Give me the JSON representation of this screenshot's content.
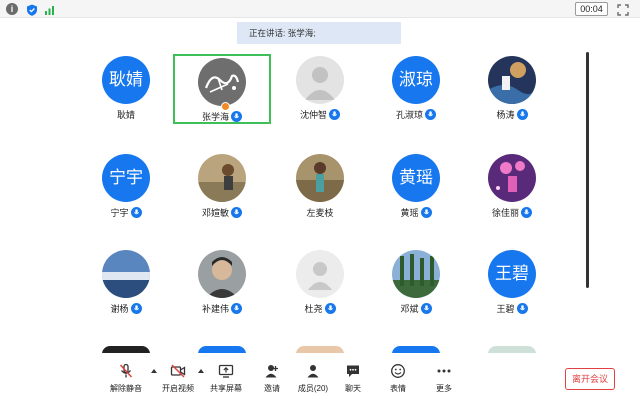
{
  "topbar": {
    "timer": "00:04"
  },
  "speaker_banner": "正在讲话: 张学海;",
  "participants": [
    {
      "name": "耿婧",
      "avatar_text": "耿婧",
      "mic": false
    },
    {
      "name": "张学海",
      "avatar_text": "",
      "mic": true,
      "active": true,
      "host": true
    },
    {
      "name": "沈仲智",
      "avatar_text": "",
      "mic": true
    },
    {
      "name": "孔淑琼",
      "avatar_text": "淑琼",
      "mic": true
    },
    {
      "name": "杨涛",
      "avatar_text": "",
      "mic": true
    },
    {
      "name": "宁宇",
      "avatar_text": "宁宇",
      "mic": true
    },
    {
      "name": "邓媗敏",
      "avatar_text": "",
      "mic": true
    },
    {
      "name": "左麦枝",
      "avatar_text": "",
      "mic": false
    },
    {
      "name": "黄瑶",
      "avatar_text": "黄瑶",
      "mic": true
    },
    {
      "name": "徐佳丽",
      "avatar_text": "",
      "mic": true
    },
    {
      "name": "谢杨",
      "avatar_text": "",
      "mic": true
    },
    {
      "name": "补建伟",
      "avatar_text": "",
      "mic": true
    },
    {
      "name": "杜尧",
      "avatar_text": "",
      "mic": true
    },
    {
      "name": "邓斌",
      "avatar_text": "",
      "mic": true
    },
    {
      "name": "王碧",
      "avatar_text": "王碧",
      "mic": true
    }
  ],
  "toolbar": {
    "unmute": "解除静音",
    "start_video": "开启视频",
    "share_screen": "共享屏幕",
    "invite": "邀请",
    "members": "成员(20)",
    "chat": "聊天",
    "reactions": "表情",
    "more": "更多",
    "leave": "离开会议"
  },
  "colors": {
    "accent": "#1677ee",
    "active_border": "#3fbf57",
    "leave": "#e04040"
  }
}
